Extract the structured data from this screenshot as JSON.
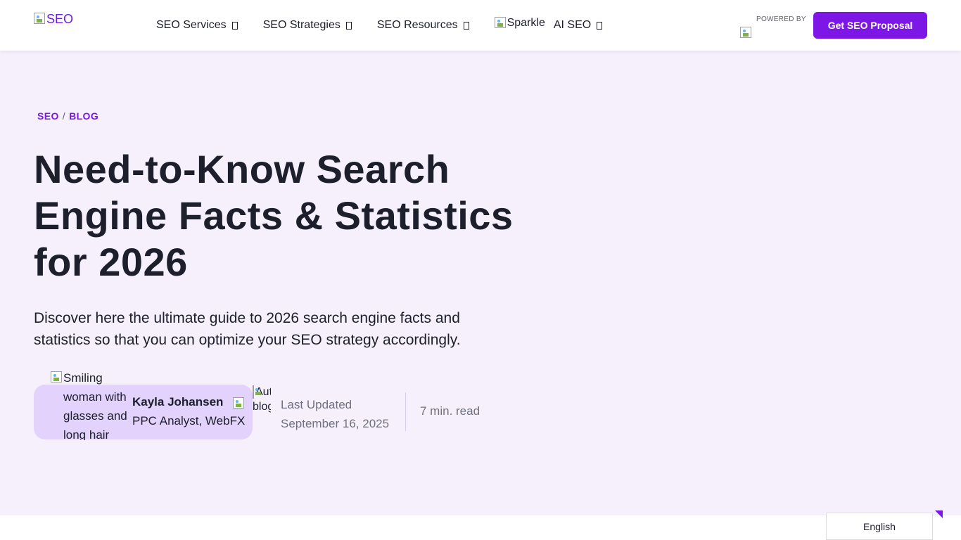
{
  "header": {
    "logo_alt": "SEO",
    "nav": [
      {
        "label": "SEO Services"
      },
      {
        "label": "SEO Strategies"
      },
      {
        "label": "SEO Resources"
      },
      {
        "label": "AI SEO",
        "icon_alt": "Sparkle"
      }
    ],
    "powered_by_label": "POWERED BY",
    "cta_label": "Get SEO Proposal"
  },
  "hero": {
    "breadcrumb": [
      {
        "label": "SEO"
      },
      {
        "label": "BLOG"
      }
    ],
    "breadcrumb_separator": "/",
    "title": "Need-to-Know Search Engine Facts & Statistics for 2026",
    "description": "Discover here the ultimate guide to 2026 search engine facts and statistics so that you can optimize your SEO strategy accordingly."
  },
  "author": {
    "photo_alt": "Smiling woman with glasses and long hair",
    "name": "Kayla Johansen",
    "role": "PPC Analyst, WebFX",
    "badge_alt": "Author blog"
  },
  "meta": {
    "updated_label": "Last Updated",
    "updated_date": "September 16, 2025",
    "read_time": "7 min. read"
  },
  "language": {
    "selected": "English"
  },
  "colors": {
    "accent": "#7c17e6",
    "hero_bg": "#f6f0fd",
    "author_card_bg": "#e3d2fb",
    "text": "#1d1f2c"
  }
}
